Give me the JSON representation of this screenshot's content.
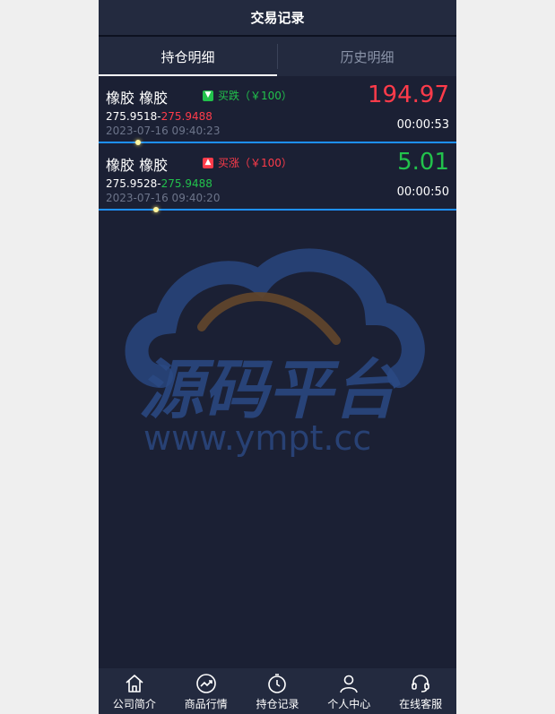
{
  "header": {
    "title": "交易记录"
  },
  "tabs": [
    {
      "label": "持仓明细",
      "active": true
    },
    {
      "label": "历史明细",
      "active": false
    }
  ],
  "trades": [
    {
      "name": "橡胶 橡胶",
      "direction_label": "买跌（￥100）",
      "direction_icon": "arrow-down-icon",
      "direction_color": "#22c24c",
      "open_price": "275.9518",
      "separator": "-",
      "current_price": "275.9488",
      "current_color": "#ff3b4a",
      "time": "2023-07-16 09:40:23",
      "pnl": "194.97",
      "pnl_color": "#ff3b4a",
      "elapsed": "00:00:53",
      "progress": 0.11
    },
    {
      "name": "橡胶 橡胶",
      "direction_label": "买涨（￥100）",
      "direction_icon": "arrow-up-icon",
      "direction_color": "#ff3b4a",
      "open_price": "275.9528",
      "separator": "-",
      "current_price": "275.9488",
      "current_color": "#22c24c",
      "time": "2023-07-16 09:40:20",
      "pnl": "5.01",
      "pnl_color": "#22c24c",
      "elapsed": "00:00:50",
      "progress": 0.16
    }
  ],
  "watermark": {
    "text": "源码平台",
    "url": "www.ympt.cc"
  },
  "footer": {
    "items": [
      {
        "label": "公司简介",
        "icon": "home-icon"
      },
      {
        "label": "商品行情",
        "icon": "trend-icon"
      },
      {
        "label": "持仓记录",
        "icon": "timer-icon"
      },
      {
        "label": "个人中心",
        "icon": "user-icon"
      },
      {
        "label": "在线客服",
        "icon": "headset-icon"
      }
    ]
  }
}
